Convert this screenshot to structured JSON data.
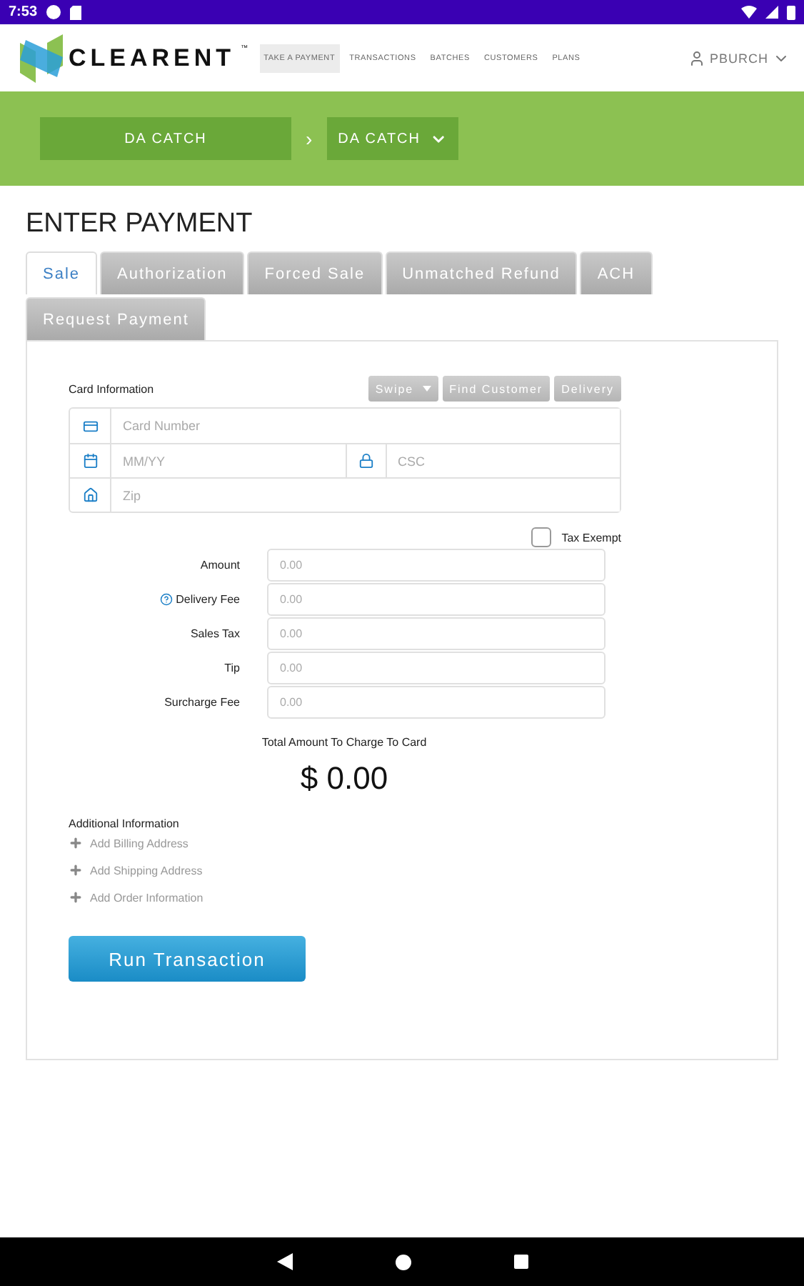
{
  "status_bar": {
    "time": "7:53"
  },
  "header": {
    "logo": "CLEARENT",
    "trademark": "™",
    "nav": [
      {
        "label": "TAKE A PAYMENT",
        "selected": true
      },
      {
        "label": "TRANSACTIONS",
        "selected": false
      },
      {
        "label": "BATCHES",
        "selected": false
      },
      {
        "label": "CUSTOMERS",
        "selected": false
      },
      {
        "label": "PLANS",
        "selected": false
      }
    ],
    "user": "PBURCH"
  },
  "breadcrumb": {
    "items": [
      {
        "label": "DA CATCH",
        "kind": "plain"
      },
      {
        "label": "DA CATCH",
        "kind": "dropdown"
      }
    ],
    "separator": "›"
  },
  "page_title": "ENTER PAYMENT",
  "tabs": [
    {
      "label": "Sale",
      "selected": true
    },
    {
      "label": "Authorization",
      "selected": false
    },
    {
      "label": "Forced Sale",
      "selected": false
    },
    {
      "label": "Unmatched Refund",
      "selected": false
    },
    {
      "label": "ACH",
      "selected": false
    },
    {
      "label": "Request Payment",
      "selected": false
    }
  ],
  "card_info": {
    "title": "Card Information",
    "buttons": [
      {
        "label": "Swipe",
        "kind": "dropdown"
      },
      {
        "label": "Find Customer",
        "kind": "plain"
      },
      {
        "label": "Delivery",
        "kind": "plain"
      }
    ],
    "card_number": {
      "placeholder": "Card Number"
    },
    "expiry": {
      "placeholder": "MM/YY"
    },
    "csc": {
      "placeholder": "CSC"
    },
    "zip": {
      "placeholder": "Zip"
    }
  },
  "tax_exempt": {
    "label": "Tax Exempt",
    "checked": false
  },
  "amounts": [
    {
      "label": "Amount",
      "placeholder": "0.00",
      "info": false
    },
    {
      "label": "Delivery Fee",
      "placeholder": "0.00",
      "info": true
    },
    {
      "label": "Sales Tax",
      "placeholder": "0.00",
      "info": false
    },
    {
      "label": "Tip",
      "placeholder": "0.00",
      "info": false
    },
    {
      "label": "Surcharge Fee",
      "placeholder": "0.00",
      "info": false
    }
  ],
  "total": {
    "label": "Total Amount To Charge To Card",
    "value": "$ 0.00"
  },
  "additional": {
    "title": "Additional Information",
    "items": [
      "Add Billing Address",
      "Add Shipping Address",
      "Add Order Information"
    ]
  },
  "run_button": "Run Transaction"
}
